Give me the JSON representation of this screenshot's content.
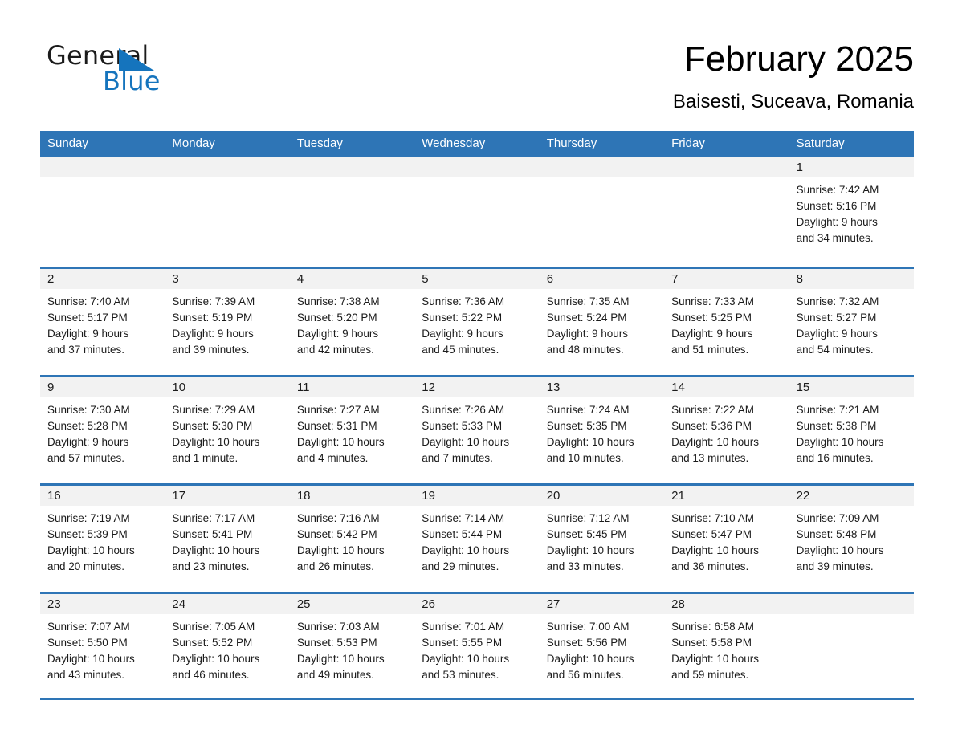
{
  "brand": {
    "name_part1": "General",
    "name_part2": "Blue",
    "triangle_color": "#1574bd"
  },
  "header": {
    "title": "February 2025",
    "subtitle": "Baisesti, Suceava, Romania"
  },
  "theme": {
    "header_blue": "#2e75b6",
    "day_band_gray": "#f2f2f2",
    "text_color": "#1b1b1b"
  },
  "weekdays": [
    "Sunday",
    "Monday",
    "Tuesday",
    "Wednesday",
    "Thursday",
    "Friday",
    "Saturday"
  ],
  "weeks": [
    [
      {
        "date": "",
        "empty": true
      },
      {
        "date": "",
        "empty": true
      },
      {
        "date": "",
        "empty": true
      },
      {
        "date": "",
        "empty": true
      },
      {
        "date": "",
        "empty": true
      },
      {
        "date": "",
        "empty": true
      },
      {
        "date": "1",
        "sunrise": "Sunrise: 7:42 AM",
        "sunset": "Sunset: 5:16 PM",
        "daylight1": "Daylight: 9 hours",
        "daylight2": "and 34 minutes."
      }
    ],
    [
      {
        "date": "2",
        "sunrise": "Sunrise: 7:40 AM",
        "sunset": "Sunset: 5:17 PM",
        "daylight1": "Daylight: 9 hours",
        "daylight2": "and 37 minutes."
      },
      {
        "date": "3",
        "sunrise": "Sunrise: 7:39 AM",
        "sunset": "Sunset: 5:19 PM",
        "daylight1": "Daylight: 9 hours",
        "daylight2": "and 39 minutes."
      },
      {
        "date": "4",
        "sunrise": "Sunrise: 7:38 AM",
        "sunset": "Sunset: 5:20 PM",
        "daylight1": "Daylight: 9 hours",
        "daylight2": "and 42 minutes."
      },
      {
        "date": "5",
        "sunrise": "Sunrise: 7:36 AM",
        "sunset": "Sunset: 5:22 PM",
        "daylight1": "Daylight: 9 hours",
        "daylight2": "and 45 minutes."
      },
      {
        "date": "6",
        "sunrise": "Sunrise: 7:35 AM",
        "sunset": "Sunset: 5:24 PM",
        "daylight1": "Daylight: 9 hours",
        "daylight2": "and 48 minutes."
      },
      {
        "date": "7",
        "sunrise": "Sunrise: 7:33 AM",
        "sunset": "Sunset: 5:25 PM",
        "daylight1": "Daylight: 9 hours",
        "daylight2": "and 51 minutes."
      },
      {
        "date": "8",
        "sunrise": "Sunrise: 7:32 AM",
        "sunset": "Sunset: 5:27 PM",
        "daylight1": "Daylight: 9 hours",
        "daylight2": "and 54 minutes."
      }
    ],
    [
      {
        "date": "9",
        "sunrise": "Sunrise: 7:30 AM",
        "sunset": "Sunset: 5:28 PM",
        "daylight1": "Daylight: 9 hours",
        "daylight2": "and 57 minutes."
      },
      {
        "date": "10",
        "sunrise": "Sunrise: 7:29 AM",
        "sunset": "Sunset: 5:30 PM",
        "daylight1": "Daylight: 10 hours",
        "daylight2": "and 1 minute."
      },
      {
        "date": "11",
        "sunrise": "Sunrise: 7:27 AM",
        "sunset": "Sunset: 5:31 PM",
        "daylight1": "Daylight: 10 hours",
        "daylight2": "and 4 minutes."
      },
      {
        "date": "12",
        "sunrise": "Sunrise: 7:26 AM",
        "sunset": "Sunset: 5:33 PM",
        "daylight1": "Daylight: 10 hours",
        "daylight2": "and 7 minutes."
      },
      {
        "date": "13",
        "sunrise": "Sunrise: 7:24 AM",
        "sunset": "Sunset: 5:35 PM",
        "daylight1": "Daylight: 10 hours",
        "daylight2": "and 10 minutes."
      },
      {
        "date": "14",
        "sunrise": "Sunrise: 7:22 AM",
        "sunset": "Sunset: 5:36 PM",
        "daylight1": "Daylight: 10 hours",
        "daylight2": "and 13 minutes."
      },
      {
        "date": "15",
        "sunrise": "Sunrise: 7:21 AM",
        "sunset": "Sunset: 5:38 PM",
        "daylight1": "Daylight: 10 hours",
        "daylight2": "and 16 minutes."
      }
    ],
    [
      {
        "date": "16",
        "sunrise": "Sunrise: 7:19 AM",
        "sunset": "Sunset: 5:39 PM",
        "daylight1": "Daylight: 10 hours",
        "daylight2": "and 20 minutes."
      },
      {
        "date": "17",
        "sunrise": "Sunrise: 7:17 AM",
        "sunset": "Sunset: 5:41 PM",
        "daylight1": "Daylight: 10 hours",
        "daylight2": "and 23 minutes."
      },
      {
        "date": "18",
        "sunrise": "Sunrise: 7:16 AM",
        "sunset": "Sunset: 5:42 PM",
        "daylight1": "Daylight: 10 hours",
        "daylight2": "and 26 minutes."
      },
      {
        "date": "19",
        "sunrise": "Sunrise: 7:14 AM",
        "sunset": "Sunset: 5:44 PM",
        "daylight1": "Daylight: 10 hours",
        "daylight2": "and 29 minutes."
      },
      {
        "date": "20",
        "sunrise": "Sunrise: 7:12 AM",
        "sunset": "Sunset: 5:45 PM",
        "daylight1": "Daylight: 10 hours",
        "daylight2": "and 33 minutes."
      },
      {
        "date": "21",
        "sunrise": "Sunrise: 7:10 AM",
        "sunset": "Sunset: 5:47 PM",
        "daylight1": "Daylight: 10 hours",
        "daylight2": "and 36 minutes."
      },
      {
        "date": "22",
        "sunrise": "Sunrise: 7:09 AM",
        "sunset": "Sunset: 5:48 PM",
        "daylight1": "Daylight: 10 hours",
        "daylight2": "and 39 minutes."
      }
    ],
    [
      {
        "date": "23",
        "sunrise": "Sunrise: 7:07 AM",
        "sunset": "Sunset: 5:50 PM",
        "daylight1": "Daylight: 10 hours",
        "daylight2": "and 43 minutes."
      },
      {
        "date": "24",
        "sunrise": "Sunrise: 7:05 AM",
        "sunset": "Sunset: 5:52 PM",
        "daylight1": "Daylight: 10 hours",
        "daylight2": "and 46 minutes."
      },
      {
        "date": "25",
        "sunrise": "Sunrise: 7:03 AM",
        "sunset": "Sunset: 5:53 PM",
        "daylight1": "Daylight: 10 hours",
        "daylight2": "and 49 minutes."
      },
      {
        "date": "26",
        "sunrise": "Sunrise: 7:01 AM",
        "sunset": "Sunset: 5:55 PM",
        "daylight1": "Daylight: 10 hours",
        "daylight2": "and 53 minutes."
      },
      {
        "date": "27",
        "sunrise": "Sunrise: 7:00 AM",
        "sunset": "Sunset: 5:56 PM",
        "daylight1": "Daylight: 10 hours",
        "daylight2": "and 56 minutes."
      },
      {
        "date": "28",
        "sunrise": "Sunrise: 6:58 AM",
        "sunset": "Sunset: 5:58 PM",
        "daylight1": "Daylight: 10 hours",
        "daylight2": "and 59 minutes."
      },
      {
        "date": "",
        "empty": true
      }
    ]
  ]
}
